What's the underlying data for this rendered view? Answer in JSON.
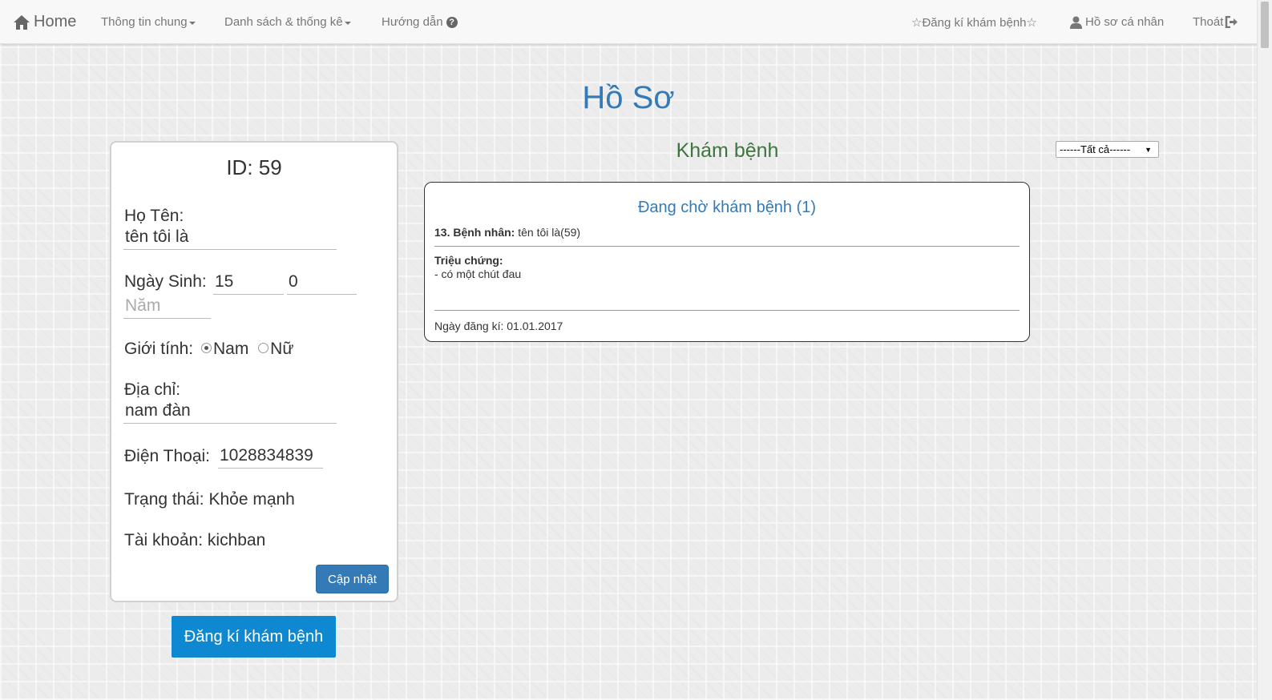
{
  "nav": {
    "home": "Home",
    "general_info": "Thông tin chung",
    "lists_stats": "Danh sách & thống kê",
    "guide": "Hướng dẫn",
    "register": "☆Đăng kí khám bệnh☆",
    "profile": "Hồ sơ cá nhân",
    "logout": "Thoát"
  },
  "page_title": "Hồ Sơ",
  "profile": {
    "id": "ID: 59",
    "name_label": "Họ Tên:",
    "name_value": "tên tôi là",
    "dob_label": "Ngày Sinh:",
    "dob_day": "15",
    "dob_month": "0",
    "dob_year_placeholder": "Năm",
    "gender_label": "Giới tính:",
    "gender_male": "Nam",
    "gender_female": "Nữ",
    "address_label": "Địa chỉ:",
    "address_value": "nam đàn",
    "phone_label": "Điện Thoại:",
    "phone_value": "1028834839",
    "status_label": "Trạng thái:",
    "status_value": "Khỏe mạnh",
    "account_label": "Tài khoản:",
    "account_value": "kichban",
    "update_button": "Cập nhật"
  },
  "register_button": "Đăng kí khám bệnh",
  "exam": {
    "section_title": "Khám bệnh",
    "filter_selected": "------Tất cả------",
    "card_title": "Đang chờ khám bệnh (1)",
    "patient_label": "13. Bệnh nhân:",
    "patient_value": "tên tôi là(59)",
    "symptom_label": "Triệu chứng:",
    "symptom_value": "- có một chút đau",
    "date_text": "Ngày đăng kí: 01.01.2017"
  },
  "colors": {
    "primary": "#337ab7",
    "success_title": "#3c763d",
    "register_button": "#0d88d1"
  }
}
